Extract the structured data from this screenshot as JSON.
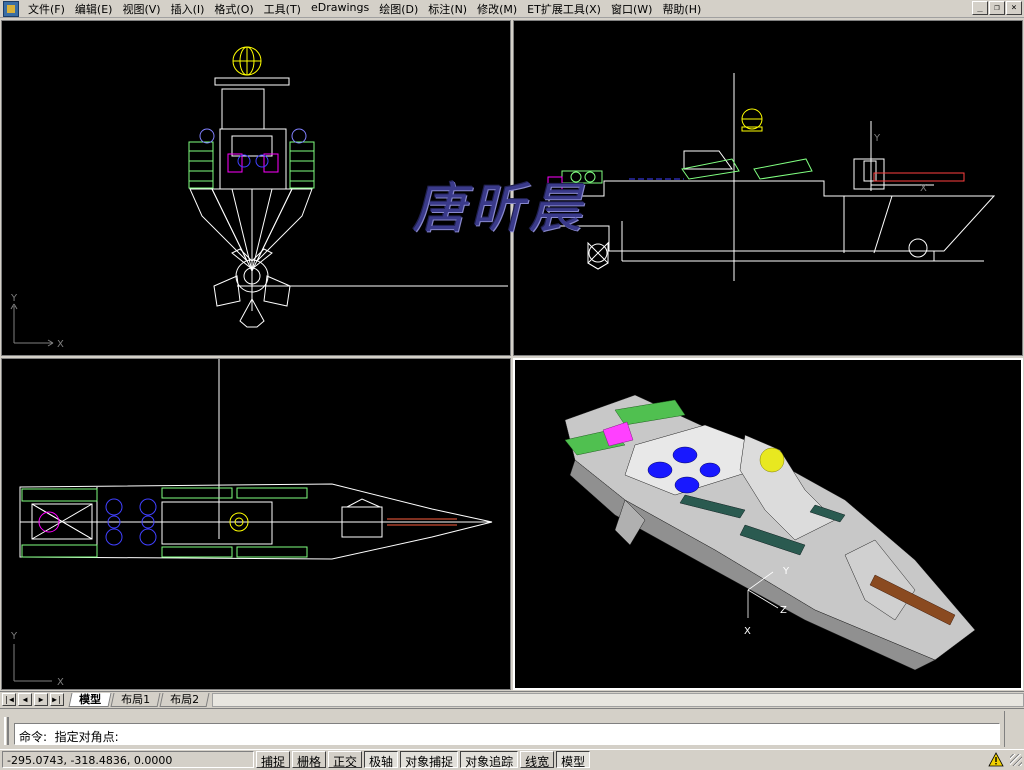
{
  "menubar": {
    "items": [
      "文件(F)",
      "编辑(E)",
      "视图(V)",
      "插入(I)",
      "格式(O)",
      "工具(T)",
      "eDrawings",
      "绘图(D)",
      "标注(N)",
      "修改(M)",
      "ET扩展工具(X)",
      "窗口(W)",
      "帮助(H)"
    ],
    "window_controls": {
      "minimize": "_",
      "restore": "❐",
      "close": "×"
    }
  },
  "viewports": {
    "ucs_x_label": "X",
    "ucs_y_label": "Y",
    "ucs_z_label": "Z",
    "watermark": "唐昕晨"
  },
  "tabs": {
    "nav": [
      "|◀",
      "◀",
      "▶",
      "▶|"
    ],
    "items": [
      "模型",
      "布局1",
      "布局2"
    ],
    "active": "模型"
  },
  "command": {
    "history": "",
    "prompt": "命令:  指定对角点:"
  },
  "status": {
    "coords": "-295.0743, -318.4836, 0.0000",
    "buttons": [
      {
        "label": "捕捉",
        "on": false
      },
      {
        "label": "栅格",
        "on": false
      },
      {
        "label": "正交",
        "on": false
      },
      {
        "label": "极轴",
        "on": true
      },
      {
        "label": "对象捕捉",
        "on": true
      },
      {
        "label": "对象追踪",
        "on": true
      },
      {
        "label": "线宽",
        "on": false
      },
      {
        "label": "模型",
        "on": true
      }
    ]
  },
  "colors": {
    "viewport_bg": "#000000",
    "wire": "#ffffff",
    "yellow": "#ffff00",
    "magenta": "#ff00ff",
    "green": "#80ff80",
    "blue": "#0000ff",
    "red": "#ff0000"
  }
}
